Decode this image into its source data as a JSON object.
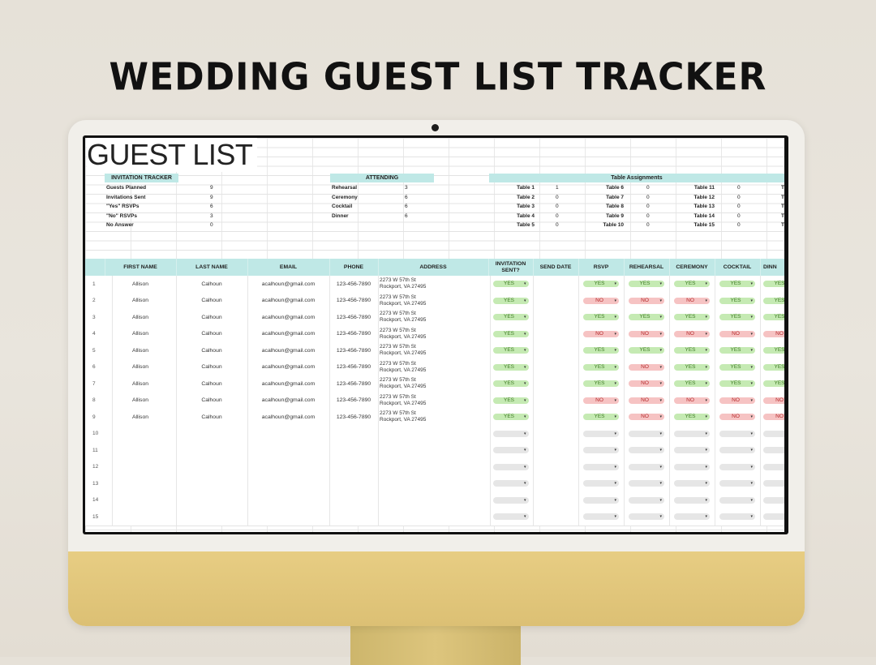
{
  "headline": "WEDDING GUEST LIST TRACKER",
  "sheet_title": "GUEST LIST",
  "invitation_tracker": {
    "header": "INVITATION TRACKER",
    "rows": [
      {
        "label": "Guests Planned",
        "value": "9"
      },
      {
        "label": "Invitations Sent",
        "value": "9"
      },
      {
        "label": "\"Yes\" RSVPs",
        "value": "6"
      },
      {
        "label": "\"No\" RSVPs",
        "value": "3"
      },
      {
        "label": "No Answer",
        "value": "0"
      }
    ]
  },
  "attending": {
    "header": "ATTENDING",
    "rows": [
      {
        "label": "Rehearsal",
        "value": "3"
      },
      {
        "label": "Ceremony",
        "value": "6"
      },
      {
        "label": "Cocktail",
        "value": "6"
      },
      {
        "label": "Dinner",
        "value": "6"
      }
    ]
  },
  "table_assignments": {
    "header": "Table Assignments",
    "col1": [
      {
        "label": "Table 1",
        "value": "1"
      },
      {
        "label": "Table 2",
        "value": "0"
      },
      {
        "label": "Table 3",
        "value": "0"
      },
      {
        "label": "Table 4",
        "value": "0"
      },
      {
        "label": "Table 5",
        "value": "0"
      }
    ],
    "col2": [
      {
        "label": "Table 6",
        "value": "0"
      },
      {
        "label": "Table 7",
        "value": "0"
      },
      {
        "label": "Table 8",
        "value": "0"
      },
      {
        "label": "Table 9",
        "value": "0"
      },
      {
        "label": "Table 10",
        "value": "0"
      }
    ],
    "col3": [
      {
        "label": "Table 11",
        "value": "0"
      },
      {
        "label": "Table 12",
        "value": "0"
      },
      {
        "label": "Table 13",
        "value": "0"
      },
      {
        "label": "Table 14",
        "value": "0"
      },
      {
        "label": "Table 15",
        "value": "0"
      }
    ],
    "col4_partial": [
      "T",
      "T",
      "T",
      "T",
      "T"
    ]
  },
  "columns": [
    "FIRST NAME",
    "LAST NAME",
    "EMAIL",
    "PHONE",
    "ADDRESS",
    "INVITATION SENT?",
    "SEND DATE",
    "RSVP",
    "REHEARSAL",
    "CEREMONY",
    "COCKTAIL",
    "DINN"
  ],
  "guests": [
    {
      "n": "1",
      "first": "Allison",
      "last": "Calhoun",
      "email": "acalhoun@gmail.com",
      "phone": "123-456-7890",
      "addr1": "2273 W 57th St",
      "addr2": "Rockport, VA 27495",
      "sent": "YES",
      "rsvp": "YES",
      "rehearsal": "YES",
      "ceremony": "YES",
      "cocktail": "YES",
      "dinner": "YES"
    },
    {
      "n": "2",
      "first": "Allison",
      "last": "Calhoun",
      "email": "acalhoun@gmail.com",
      "phone": "123-456-7890",
      "addr1": "2273 W 57th St",
      "addr2": "Rockport, VA 27495",
      "sent": "YES",
      "rsvp": "NO",
      "rehearsal": "NO",
      "ceremony": "NO",
      "cocktail": "YES",
      "dinner": "YES"
    },
    {
      "n": "3",
      "first": "Allison",
      "last": "Calhoun",
      "email": "acalhoun@gmail.com",
      "phone": "123-456-7890",
      "addr1": "2273 W 57th St",
      "addr2": "Rockport, VA 27495",
      "sent": "YES",
      "rsvp": "YES",
      "rehearsal": "YES",
      "ceremony": "YES",
      "cocktail": "YES",
      "dinner": "YES"
    },
    {
      "n": "4",
      "first": "Allison",
      "last": "Calhoun",
      "email": "acalhoun@gmail.com",
      "phone": "123-456-7890",
      "addr1": "2273 W 57th St",
      "addr2": "Rockport, VA 27495",
      "sent": "YES",
      "rsvp": "NO",
      "rehearsal": "NO",
      "ceremony": "NO",
      "cocktail": "NO",
      "dinner": "NO"
    },
    {
      "n": "5",
      "first": "Allison",
      "last": "Calhoun",
      "email": "acalhoun@gmail.com",
      "phone": "123-456-7890",
      "addr1": "2273 W 57th St",
      "addr2": "Rockport, VA 27495",
      "sent": "YES",
      "rsvp": "YES",
      "rehearsal": "YES",
      "ceremony": "YES",
      "cocktail": "YES",
      "dinner": "YES"
    },
    {
      "n": "6",
      "first": "Allison",
      "last": "Calhoun",
      "email": "acalhoun@gmail.com",
      "phone": "123-456-7890",
      "addr1": "2273 W 57th St",
      "addr2": "Rockport, VA 27495",
      "sent": "YES",
      "rsvp": "YES",
      "rehearsal": "NO",
      "ceremony": "YES",
      "cocktail": "YES",
      "dinner": "YES"
    },
    {
      "n": "7",
      "first": "Allison",
      "last": "Calhoun",
      "email": "acalhoun@gmail.com",
      "phone": "123-456-7890",
      "addr1": "2273 W 57th St",
      "addr2": "Rockport, VA 27495",
      "sent": "YES",
      "rsvp": "YES",
      "rehearsal": "NO",
      "ceremony": "YES",
      "cocktail": "YES",
      "dinner": "YES"
    },
    {
      "n": "8",
      "first": "Allison",
      "last": "Calhoun",
      "email": "acalhoun@gmail.com",
      "phone": "123-456-7890",
      "addr1": "2273 W 57th St",
      "addr2": "Rockport, VA 27495",
      "sent": "YES",
      "rsvp": "NO",
      "rehearsal": "NO",
      "ceremony": "NO",
      "cocktail": "NO",
      "dinner": "NO"
    },
    {
      "n": "9",
      "first": "Allison",
      "last": "Calhoun",
      "email": "acalhoun@gmail.com",
      "phone": "123-456-7890",
      "addr1": "2273 W 57th St",
      "addr2": "Rockport, VA 27495",
      "sent": "YES",
      "rsvp": "YES",
      "rehearsal": "NO",
      "ceremony": "YES",
      "cocktail": "NO",
      "dinner": "NO"
    }
  ],
  "empty_rows": [
    "10",
    "11",
    "12",
    "13",
    "14",
    "15"
  ],
  "colors": {
    "header_teal": "#bfe8e6",
    "yes": "#c5eab3",
    "no": "#f6c3c3",
    "stand": "#dcc074"
  }
}
